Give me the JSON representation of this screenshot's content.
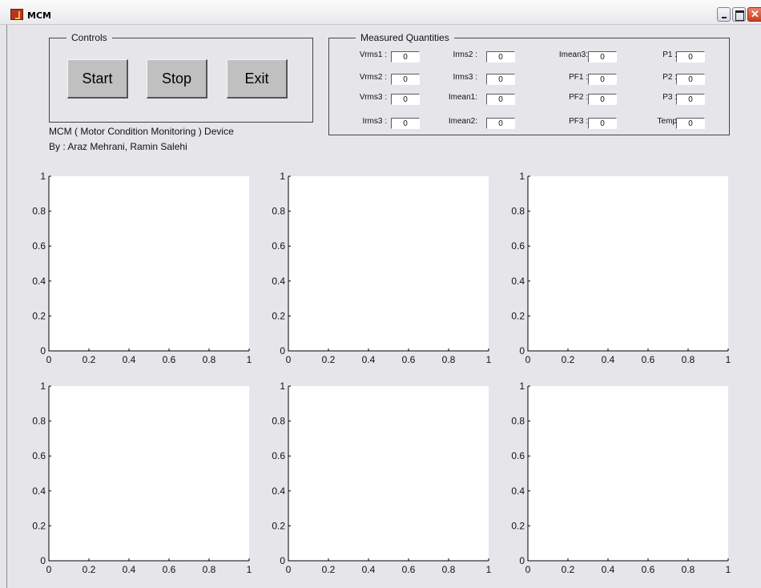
{
  "window": {
    "title": "MCM"
  },
  "controls": {
    "title": "Controls",
    "start_label": "Start",
    "stop_label": "Stop",
    "exit_label": "Exit"
  },
  "measured": {
    "title": "Measured Quantities",
    "items": [
      {
        "label": "Vrms1 :",
        "value": "0"
      },
      {
        "label": "Irms2 :",
        "value": "0"
      },
      {
        "label": "Imean3:",
        "value": "0"
      },
      {
        "label": "P1 :",
        "value": "0"
      },
      {
        "label": "Vrms2 :",
        "value": "0"
      },
      {
        "label": "Irms3 :",
        "value": "0"
      },
      {
        "label": "PF1 :",
        "value": "0"
      },
      {
        "label": "P2 :",
        "value": "0"
      },
      {
        "label": "Vrms3 :",
        "value": "0"
      },
      {
        "label": "Imean1:",
        "value": "0"
      },
      {
        "label": "PF2 :",
        "value": "0"
      },
      {
        "label": "P3 :",
        "value": "0"
      },
      {
        "label": "Irms3 :",
        "value": "0"
      },
      {
        "label": "Imean2:",
        "value": "0"
      },
      {
        "label": "PF3 :",
        "value": "0"
      },
      {
        "label": "Temp",
        "value": "0"
      }
    ]
  },
  "info": {
    "line1": "MCM ( Motor Condition Monitoring ) Device",
    "line2": "By : Araz Mehrani, Ramin Salehi"
  },
  "chart_data": [
    {
      "type": "line",
      "series": [],
      "xlim": [
        0,
        1
      ],
      "ylim": [
        0,
        1
      ],
      "xticks": [
        "0",
        "0.2",
        "0.4",
        "0.6",
        "0.8",
        "1"
      ],
      "yticks": [
        "0",
        "0.2",
        "0.4",
        "0.6",
        "0.8",
        "1"
      ]
    },
    {
      "type": "line",
      "series": [],
      "xlim": [
        0,
        1
      ],
      "ylim": [
        0,
        1
      ],
      "xticks": [
        "0",
        "0.2",
        "0.4",
        "0.6",
        "0.8",
        "1"
      ],
      "yticks": [
        "0",
        "0.2",
        "0.4",
        "0.6",
        "0.8",
        "1"
      ]
    },
    {
      "type": "line",
      "series": [],
      "xlim": [
        0,
        1
      ],
      "ylim": [
        0,
        1
      ],
      "xticks": [
        "0",
        "0.2",
        "0.4",
        "0.6",
        "0.8",
        "1"
      ],
      "yticks": [
        "0",
        "0.2",
        "0.4",
        "0.6",
        "0.8",
        "1"
      ]
    },
    {
      "type": "line",
      "series": [],
      "xlim": [
        0,
        1
      ],
      "ylim": [
        0,
        1
      ],
      "xticks": [
        "0",
        "0.2",
        "0.4",
        "0.6",
        "0.8",
        "1"
      ],
      "yticks": [
        "0",
        "0.2",
        "0.4",
        "0.6",
        "0.8",
        "1"
      ]
    },
    {
      "type": "line",
      "series": [],
      "xlim": [
        0,
        1
      ],
      "ylim": [
        0,
        1
      ],
      "xticks": [
        "0",
        "0.2",
        "0.4",
        "0.6",
        "0.8",
        "1"
      ],
      "yticks": [
        "0",
        "0.2",
        "0.4",
        "0.6",
        "0.8",
        "1"
      ]
    },
    {
      "type": "line",
      "series": [],
      "xlim": [
        0,
        1
      ],
      "ylim": [
        0,
        1
      ],
      "xticks": [
        "0",
        "0.2",
        "0.4",
        "0.6",
        "0.8",
        "1"
      ],
      "yticks": [
        "0",
        "0.2",
        "0.4",
        "0.6",
        "0.8",
        "1"
      ]
    }
  ]
}
